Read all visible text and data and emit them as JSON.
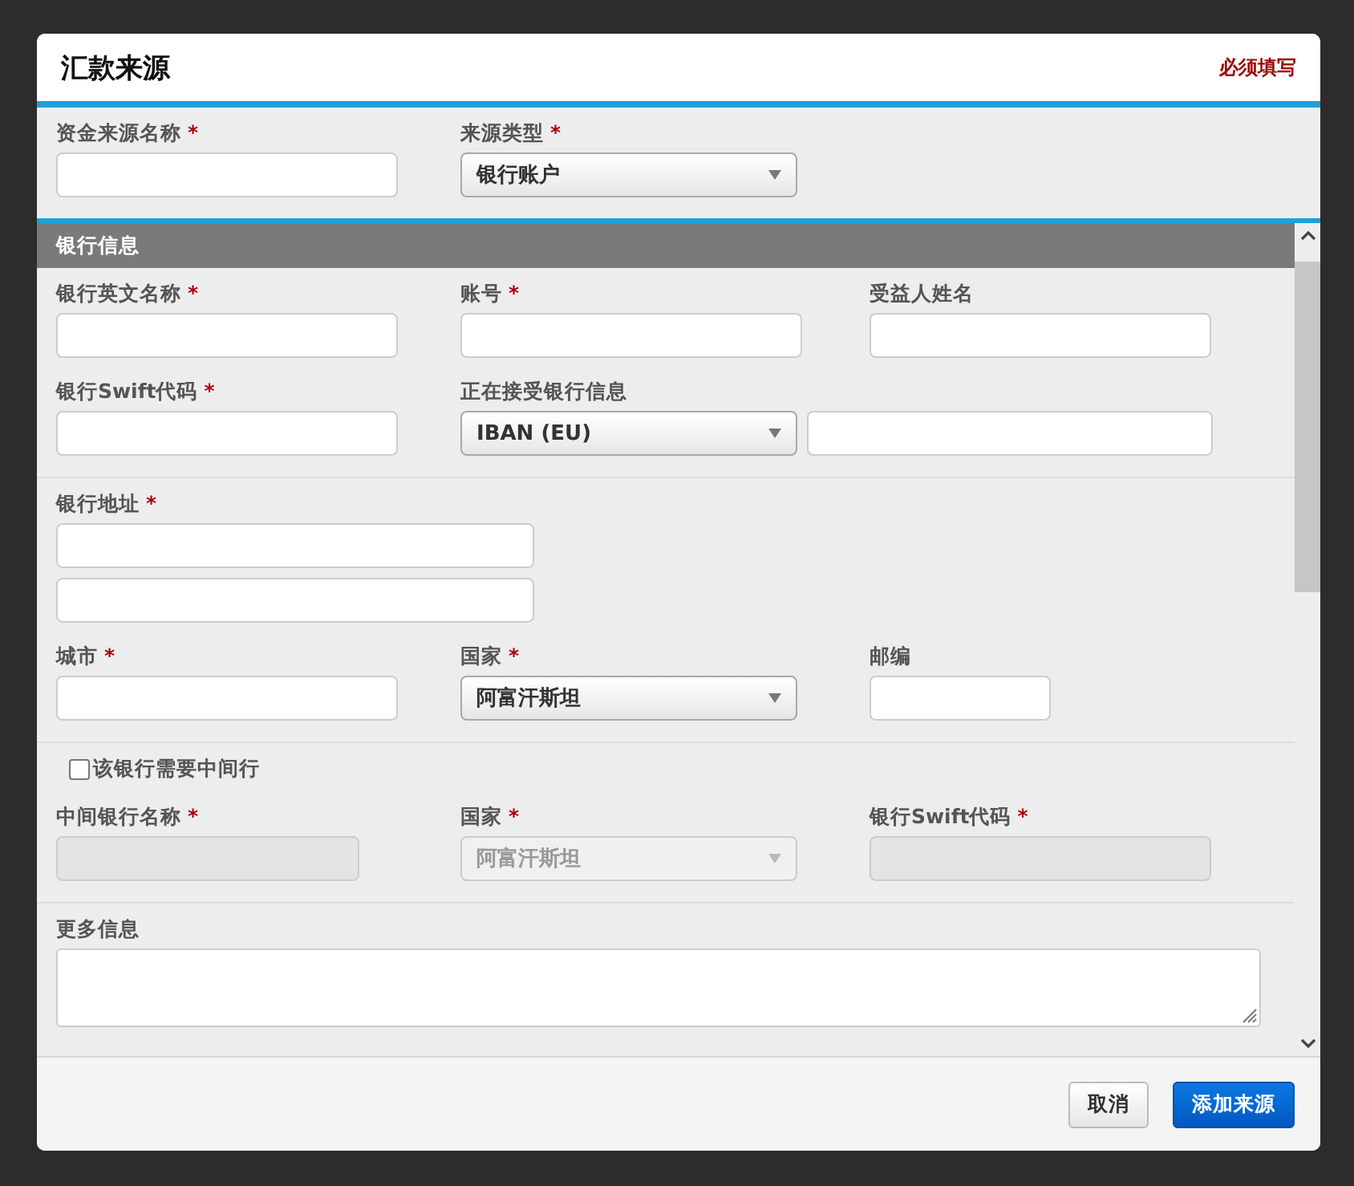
{
  "dialog": {
    "title": "汇款来源",
    "required_note": "必须填写"
  },
  "top": {
    "rows": [
      [
        {
          "label": "资金来源名称",
          "mark": "*",
          "controls": [
            {
              "kind": "text"
            }
          ]
        },
        {
          "label": "来源类型",
          "mark": "*",
          "controls": [
            {
              "kind": "select",
              "value": "银行账户"
            }
          ]
        }
      ]
    ]
  },
  "section": {
    "title": "银行信息"
  },
  "groups": [
    {
      "rows": [
        [
          {
            "label": "银行英文名称",
            "mark": "*",
            "controls": [
              {
                "kind": "text"
              }
            ]
          },
          {
            "label": "账号",
            "mark": "*",
            "controls": [
              {
                "kind": "text"
              }
            ]
          },
          {
            "label": "受益人姓名",
            "controls": [
              {
                "kind": "text"
              }
            ]
          }
        ],
        [
          {
            "label": "银行Swift代码",
            "mark": "*",
            "controls": [
              {
                "kind": "text"
              }
            ]
          },
          {
            "label": "正在接受银行信息",
            "controls": [
              {
                "kind": "select",
                "value": "IBAN (EU)"
              },
              {
                "kind": "text"
              }
            ]
          }
        ]
      ]
    },
    {
      "rows": [
        [
          {
            "label": "银行地址",
            "mark": "*",
            "controls": [
              {
                "kind": "text"
              },
              {
                "kind": "text"
              }
            ]
          }
        ],
        [
          {
            "label": "城市",
            "mark": "*",
            "controls": [
              {
                "kind": "text"
              }
            ]
          },
          {
            "label": "国家",
            "mark": "*",
            "controls": [
              {
                "kind": "select",
                "value": "阿富汗斯坦"
              }
            ]
          },
          {
            "label": "邮编",
            "controls": [
              {
                "kind": "text"
              }
            ]
          }
        ]
      ]
    },
    {
      "rows": [
        [
          {
            "controls": [
              {
                "kind": "checkbox",
                "label": "该银行需要中间行",
                "checked": false
              }
            ]
          }
        ],
        [
          {
            "label": "中间银行名称",
            "mark": "*",
            "controls": [
              {
                "kind": "text",
                "disabled": true
              }
            ]
          },
          {
            "label": "国家",
            "mark": "*",
            "controls": [
              {
                "kind": "select",
                "value": "阿富汗斯坦",
                "disabled": true
              }
            ]
          },
          {
            "label": "银行Swift代码",
            "mark": "*",
            "controls": [
              {
                "kind": "text",
                "disabled": true
              }
            ]
          }
        ]
      ]
    },
    {
      "rows": [
        [
          {
            "label": "更多信息",
            "controls": [
              {
                "kind": "textarea"
              }
            ]
          }
        ]
      ]
    }
  ],
  "buttons": [
    {
      "label": "取消",
      "kind": "secondary"
    },
    {
      "label": "添加来源",
      "kind": "primary"
    }
  ]
}
